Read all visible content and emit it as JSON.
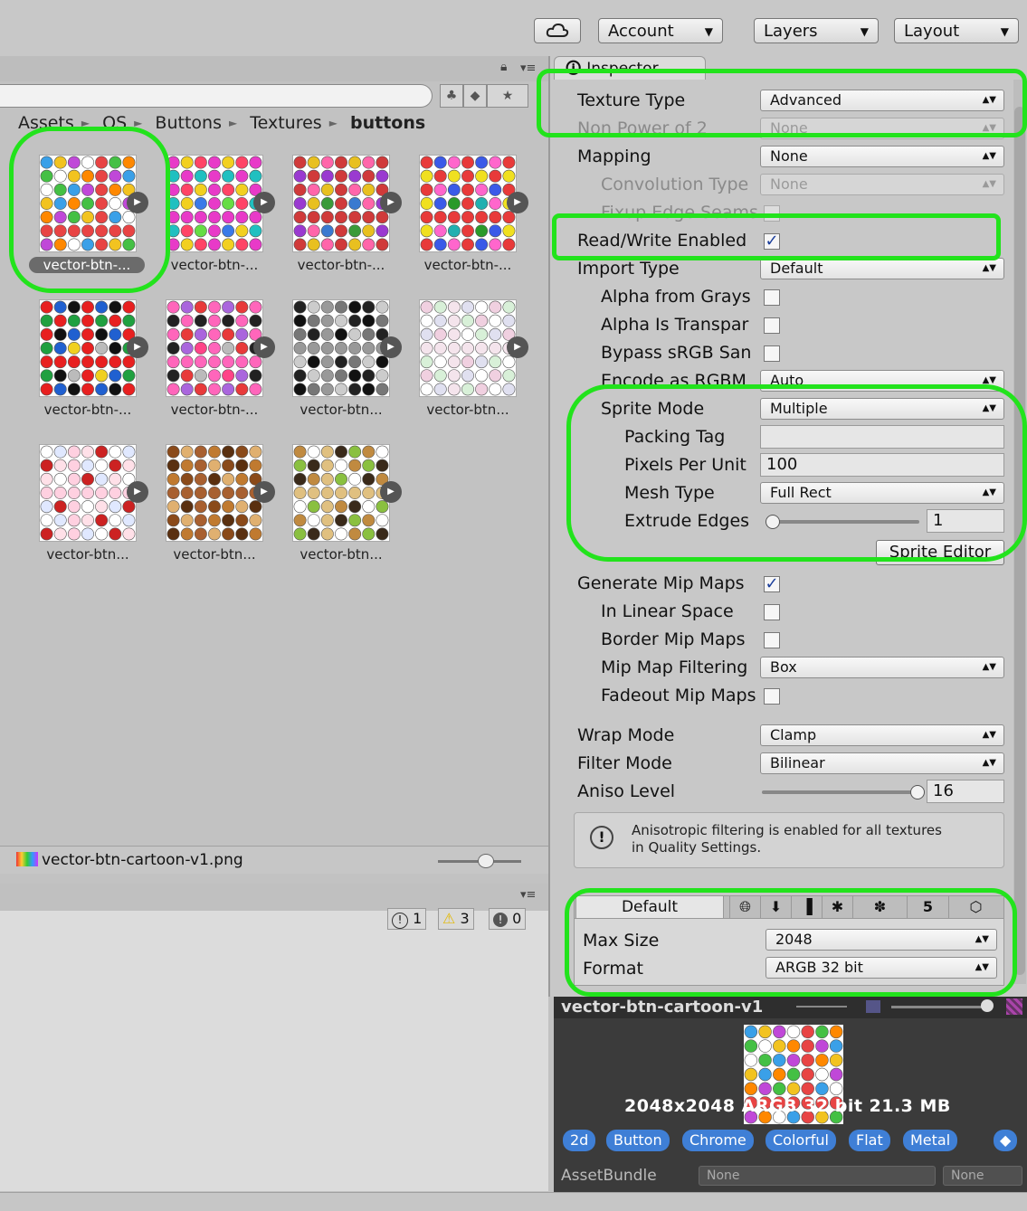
{
  "toolbar": {
    "account": "Account",
    "layers": "Layers",
    "layout": "Layout"
  },
  "project": {
    "breadcrumb": [
      "Assets",
      "OS",
      "Buttons",
      "Textures",
      "buttons"
    ],
    "tiles": [
      {
        "label": "vector-btn-...",
        "selected": true
      },
      {
        "label": "vector-btn-..."
      },
      {
        "label": "vector-btn-..."
      },
      {
        "label": "vector-btn-..."
      },
      {
        "label": "vector-btn-..."
      },
      {
        "label": "vector-btn-..."
      },
      {
        "label": "vector-btn..."
      },
      {
        "label": "vector-btn..."
      },
      {
        "label": "vector-btn..."
      },
      {
        "label": "vector-btn..."
      },
      {
        "label": "vector-btn..."
      }
    ],
    "status_file": "vector-btn-cartoon-v1.png"
  },
  "console": {
    "info_count": "1",
    "warn_count": "3",
    "error_count": "0"
  },
  "inspector": {
    "tab": "Inspector",
    "texture_type_label": "Texture Type",
    "texture_type_value": "Advanced",
    "non_power_label": "Non Power of 2",
    "non_power_value": "None",
    "mapping_label": "Mapping",
    "mapping_value": "None",
    "convolution_label": "Convolution Type",
    "convolution_value": "None",
    "fixup_label": "Fixup Edge Seams",
    "readwrite_label": "Read/Write Enabled",
    "import_type_label": "Import Type",
    "import_type_value": "Default",
    "alpha_grays_label": "Alpha from Grays",
    "alpha_transparency_label": "Alpha Is Transpar",
    "bypass_srgb_label": "Bypass sRGB San",
    "encode_rgbm_label": "Encode as RGBM",
    "encode_rgbm_value": "Auto",
    "sprite_mode_label": "Sprite Mode",
    "sprite_mode_value": "Multiple",
    "packing_tag_label": "Packing Tag",
    "packing_tag_value": "",
    "ppu_label": "Pixels Per Unit",
    "ppu_value": "100",
    "mesh_type_label": "Mesh Type",
    "mesh_type_value": "Full Rect",
    "extrude_label": "Extrude Edges",
    "extrude_value": "1",
    "extrude_fraction": 0.0,
    "sprite_editor_button": "Sprite Editor",
    "gen_mip_label": "Generate Mip Maps",
    "linear_space_label": "In Linear Space",
    "border_mip_label": "Border Mip Maps",
    "mip_filter_label": "Mip Map Filtering",
    "mip_filter_value": "Box",
    "fadeout_label": "Fadeout Mip Maps",
    "wrap_label": "Wrap Mode",
    "wrap_value": "Clamp",
    "filter_label": "Filter Mode",
    "filter_value": "Bilinear",
    "aniso_label": "Aniso Level",
    "aniso_value": "16",
    "aniso_fraction": 1.0,
    "help_text_line1": "Anisotropic filtering is enabled for all textures",
    "help_text_line2": "in Quality Settings.",
    "platform_default": "Default",
    "max_size_label": "Max Size",
    "max_size_value": "2048",
    "format_label": "Format",
    "format_value": "ARGB 32 bit"
  },
  "preview": {
    "name": "vector-btn-cartoon-v1",
    "info": "2048x2048  ARGB 32 bit   21.3 MB",
    "tags": [
      "2d",
      "Button",
      "Chrome",
      "Colorful",
      "Flat",
      "Metal"
    ],
    "assetbundle_label": "AssetBundle",
    "assetbundle_value": "None",
    "assetbundle_variant": "None"
  },
  "colors": {
    "highlight": "#22e31c",
    "tag_blue": "#3f7fd6"
  }
}
